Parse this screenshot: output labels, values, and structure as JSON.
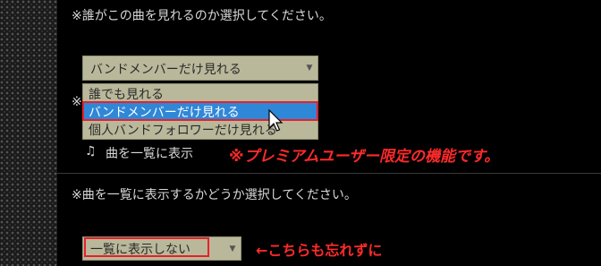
{
  "visibility": {
    "instruction": "※誰がこの曲を見れるのか選択してください。",
    "select_value": "バンドメンバーだけ見れる",
    "options": [
      "誰でも見れる",
      "バンドメンバーだけ見れる",
      "個人バンドフォロワーだけ見れる"
    ],
    "hidden_prefix": "※"
  },
  "list_display": {
    "checkbox_label": "曲を一覧に表示",
    "instruction": "※曲を一覧に表示するかどうか選択してください。",
    "select_value": "一覧に表示しない"
  },
  "annotations": {
    "premium_note": "※プレミアムユーザー限定の機能です。",
    "reminder": "←こちらも忘れずに"
  },
  "icons": {
    "dropdown_arrow": "chevron-down-icon",
    "music_note": "music-note-icon",
    "cursor": "mouse-pointer-icon"
  },
  "colors": {
    "select_bg": "#b9b89a",
    "highlight": "#2f87d8",
    "emphasis_red": "#e8202a"
  }
}
